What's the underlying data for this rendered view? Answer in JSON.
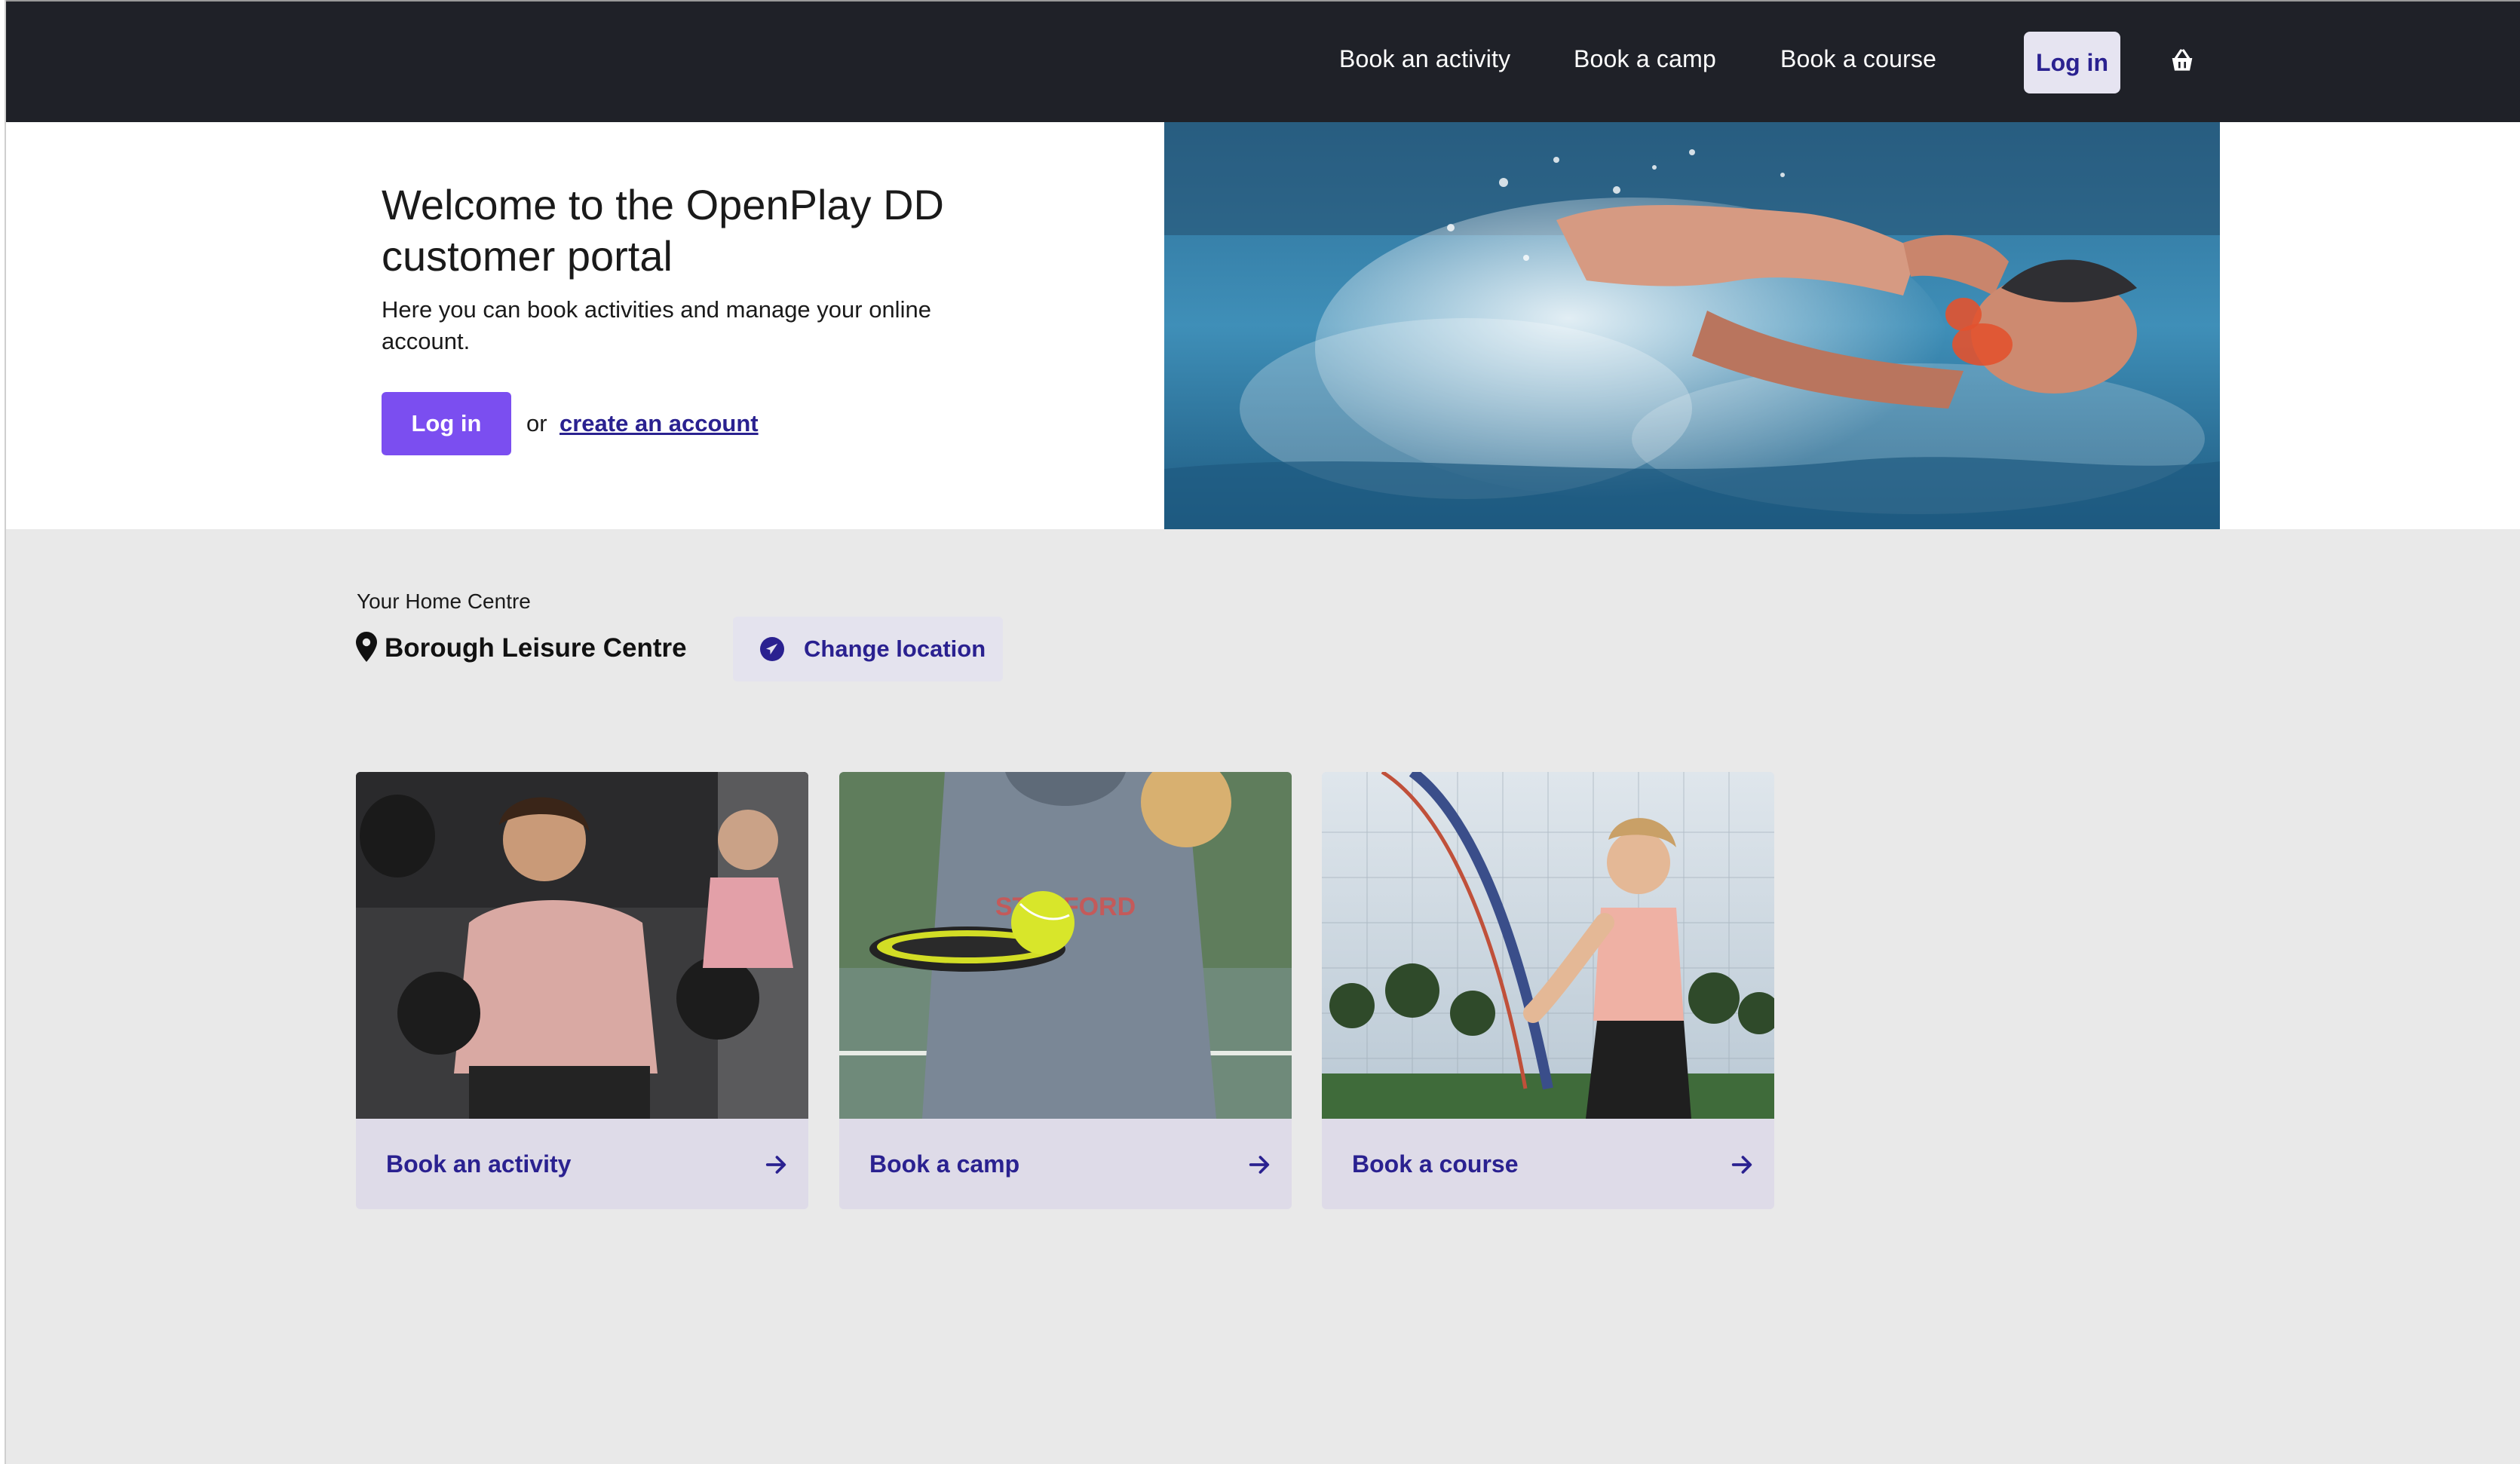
{
  "nav": {
    "links": [
      "Book an activity",
      "Book a camp",
      "Book a course"
    ],
    "login_label": "Log in",
    "basket_icon": "basket-icon"
  },
  "hero": {
    "title": "Welcome to the OpenPlay DD customer portal",
    "subtitle": "Here you can book activities and manage your online account.",
    "login_label": "Log in",
    "or_text": "or",
    "create_account_label": "create an account",
    "image": "swimmer-photo"
  },
  "home_centre": {
    "label": "Your Home Centre",
    "name": "Borough Leisure Centre",
    "change_label": "Change location",
    "pin_icon": "location-pin-icon",
    "change_icon": "navigation-icon"
  },
  "cards": [
    {
      "label": "Book an activity",
      "image": "boxing-photo",
      "icon": "arrow-right-icon"
    },
    {
      "label": "Book a camp",
      "image": "tennis-ball-photo",
      "icon": "arrow-right-icon"
    },
    {
      "label": "Book a course",
      "image": "tennis-player-photo",
      "icon": "arrow-right-icon"
    }
  ],
  "colors": {
    "topbar": "#1f2128",
    "primary": "#7b4ef0",
    "link": "#2a2190",
    "card_footer": "#dedbe8",
    "page_bg": "#e9e9e9"
  }
}
